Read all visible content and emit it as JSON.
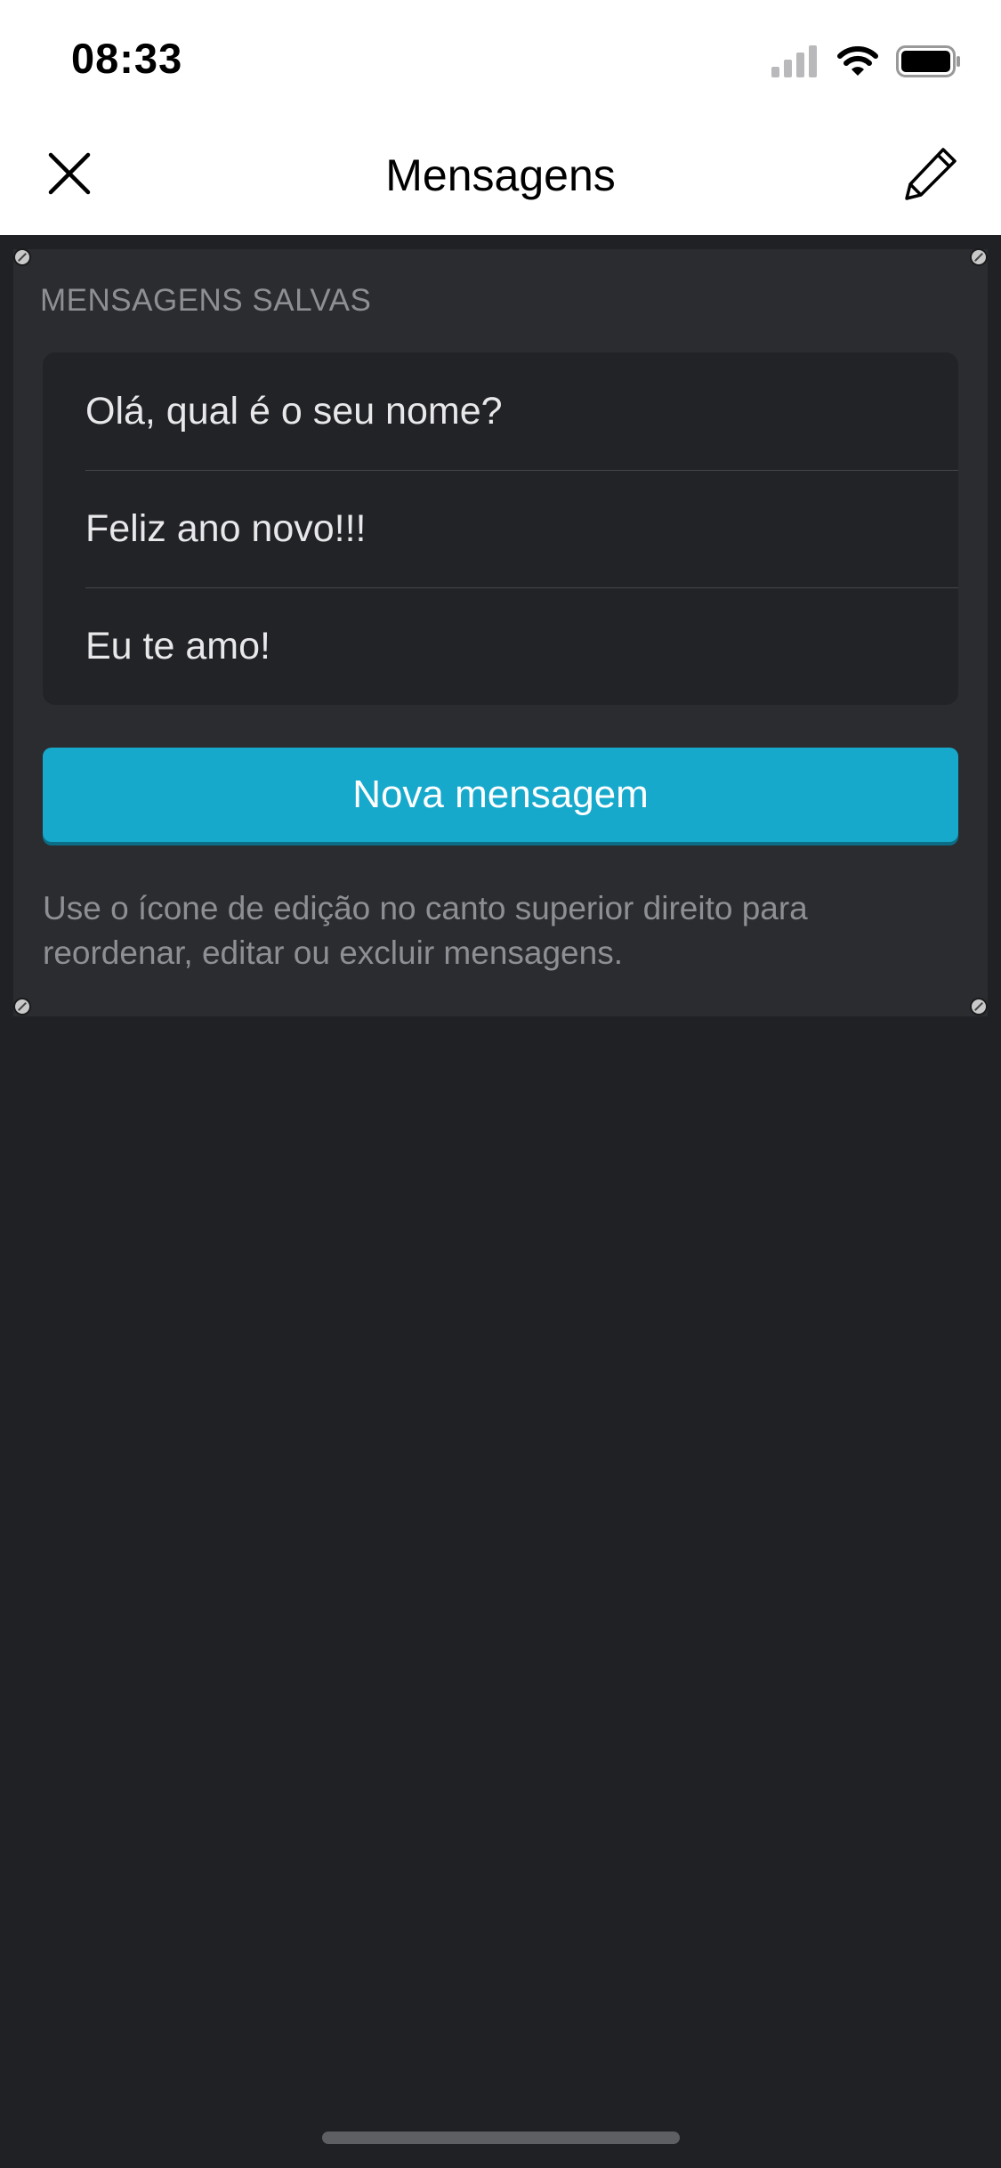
{
  "status_bar": {
    "time": "08:33",
    "icons": [
      "cellular-signal-icon",
      "wifi-icon",
      "battery-icon"
    ]
  },
  "nav": {
    "title": "Mensagens",
    "left_icon": "close-icon",
    "right_icon": "pencil-edit-icon"
  },
  "saved": {
    "section_label": "MENSAGENS SALVAS",
    "messages": [
      "Olá, qual é o seu nome?",
      "Feliz ano novo!!!",
      "Eu te amo!"
    ]
  },
  "new_message_button": {
    "label": "Nova mensagem"
  },
  "hint_text": "Use o ícone de edição no canto superior direito para reordenar, editar ou excluir mensagens.",
  "colors": {
    "header_bg": "#ffffff",
    "app_bg": "#202124",
    "panel_bg": "#2b2c2f",
    "list_bg": "#222326",
    "accent": "#16a9cc",
    "muted_text": "#8e8f94"
  }
}
